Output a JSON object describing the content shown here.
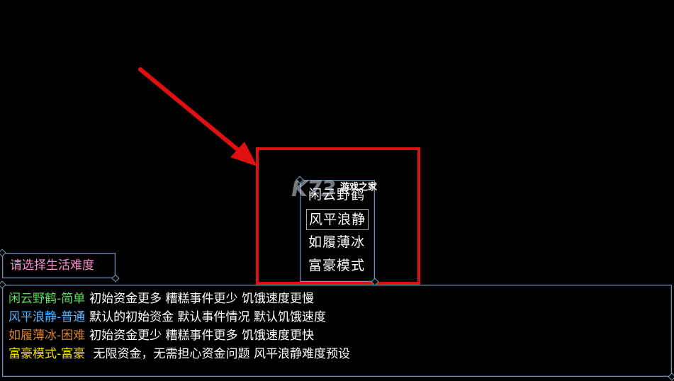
{
  "menu": {
    "items": [
      {
        "label": "闲云野鹤"
      },
      {
        "label": "风平浪静",
        "selected": true
      },
      {
        "label": "如履薄冰"
      },
      {
        "label": "富豪模式"
      }
    ]
  },
  "watermark": {
    "logo": "K73",
    "text": "游戏之家"
  },
  "prompt": {
    "text": "请选择生活难度"
  },
  "descriptions": [
    {
      "mode": "闲云野鹤-简单",
      "text": "初始资金更多  糟糕事件更少 饥饿速度更慢",
      "color": "#5ee05e"
    },
    {
      "mode": "风平浪静-普通",
      "text": "默认的初始资金 默认事件情况 默认饥饿速度",
      "color": "#58b6ff"
    },
    {
      "mode": "如履薄冰-困难",
      "text": "初始资金更少  糟糕事件更多 饥饿速度更快",
      "color": "#d9802a"
    },
    {
      "mode": "富豪模式-富豪",
      "text": " 无限资金，无需担心资金问题 风平浪静难度预设",
      "color": "#f5e000"
    }
  ],
  "colors": {
    "highlight": "#e01010",
    "panel_border": "#6f8fb0"
  }
}
